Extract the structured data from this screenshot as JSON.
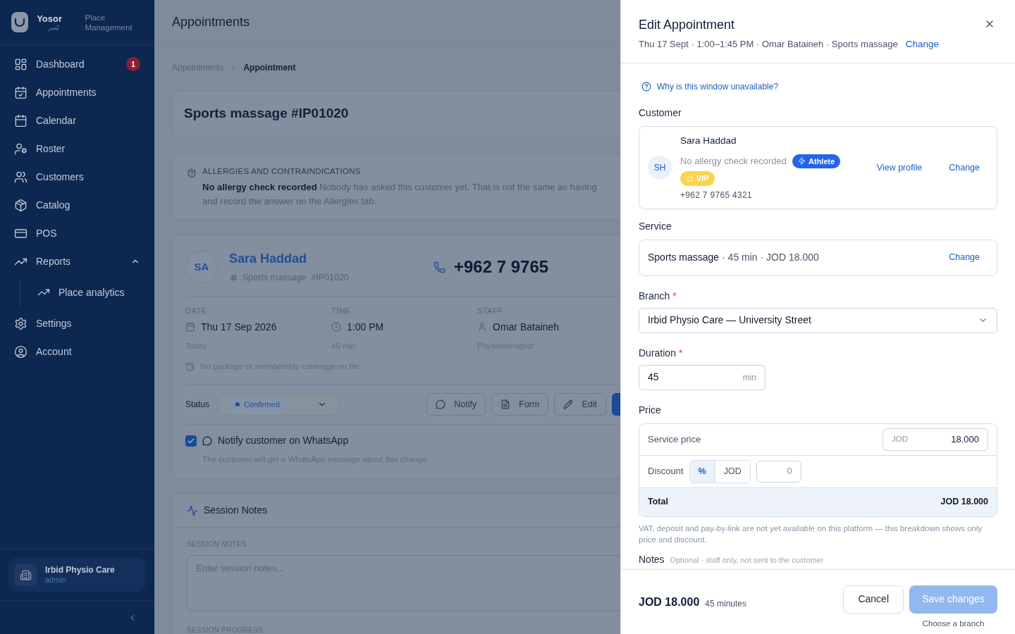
{
  "sidebar": {
    "brand": "Yosor",
    "brand_arabic": "يُسر",
    "subtitle": "Place Management",
    "items": [
      {
        "label": "Dashboard",
        "badge": "1",
        "selected": false
      },
      {
        "label": "Appointments",
        "selected": false
      },
      {
        "label": "Calendar",
        "selected": false
      },
      {
        "label": "Roster",
        "selected": false
      },
      {
        "label": "Customers",
        "selected": false
      },
      {
        "label": "Catalog",
        "selected": false
      },
      {
        "label": "POS",
        "selected": false
      },
      {
        "label": "Reports",
        "selected": false,
        "expanded": true,
        "children": [
          {
            "label": "Place analytics",
            "selected": false
          }
        ]
      },
      {
        "label": "Settings",
        "selected": false
      },
      {
        "label": "Account",
        "selected": false
      }
    ],
    "workspace": {
      "name": "Irbid Physio Care",
      "role": "admin"
    }
  },
  "main": {
    "title": "Appointments",
    "breadcrumb": [
      "Appointments",
      "Appointment"
    ],
    "heading": "Sports massage #IP01020",
    "allergy": {
      "title": "ALLERGIES AND CONTRAINDICATIONS",
      "lines": [
        "**No allergy check recorded** Nobody has asked this customer yet. That is not the same as having",
        "and record the answer on the Allergies tab."
      ]
    },
    "customer": {
      "initials": "SA",
      "name": "Sara Haddad",
      "ref": "Sports massage  #IP01020",
      "phone": "+962 7 9765"
    },
    "details": [
      {
        "label": "DATE",
        "value": "Thu 17 Sep 2026",
        "sub": "Today"
      },
      {
        "label": "TIME",
        "value": "1:00 PM",
        "sub": "45 min"
      },
      {
        "label": "STAFF",
        "value": "Omar Bataineh",
        "sub": "Physiotherapist"
      }
    ],
    "coverage": "No package or membership coverage on file",
    "status": {
      "label": "Status",
      "value": "Confirmed"
    },
    "actions": [
      "Notify",
      "Form",
      "Edit"
    ],
    "whatsapp": {
      "checked": true,
      "label": "Notify customer on WhatsApp",
      "hint": "The customer will get a WhatsApp message about this change."
    },
    "session": {
      "title": "Session Notes",
      "notes_label": "SESSION NOTES",
      "placeholder": "Enter session notes...",
      "progress_label": "SESSION PROGRESS"
    }
  },
  "drawer": {
    "title": "Edit Appointment",
    "subtitle": "Thu 17 Sept · 1:00–1:45 PM · Omar Bataineh · Sports massage",
    "change": "Change",
    "help": "Why is this window unavailable?",
    "customer": {
      "label": "Customer",
      "initials": "SH",
      "name": "Sara Haddad",
      "allergy": "No allergy check recorded",
      "tags": [
        {
          "label": "Athlete",
          "color": "#2563eb"
        },
        {
          "label": "VIP",
          "color": "#fcd34d"
        }
      ],
      "phone": "+962 7 9765 4321",
      "view": "View profile",
      "change": "Change"
    },
    "service": {
      "label": "Service",
      "text": "**Sports massage** · 45 min · JOD 18.000",
      "change": "Change"
    },
    "branch": {
      "label": "Branch",
      "required_mark": "*",
      "value": "Irbid Physio Care — University Street"
    },
    "duration": {
      "label": "Duration",
      "required_mark": "*",
      "value": "45",
      "unit": "min"
    },
    "price": {
      "label": "Price",
      "service_label": "Service price",
      "currency": "JOD",
      "service_value": "18.000",
      "discount_label": "Discount",
      "discount_modes": [
        {
          "label": "%",
          "selected": true
        },
        {
          "label": "JOD",
          "selected": false
        }
      ],
      "discount_value": "0",
      "total_label": "Total",
      "total_value": "JOD 18.000"
    },
    "disclaimer": "VAT, deposit and pay-by-link are not yet available on this platform — this breakdown shows only price and discount.",
    "notes": {
      "label": "Notes",
      "hint": "Optional · staff only, not sent to the customer"
    },
    "footer": {
      "total": "JOD 18.000",
      "minutes": "45 minutes",
      "cancel": "Cancel",
      "save": "Save changes",
      "save_disabled": true,
      "save_hint": "Choose a branch"
    }
  }
}
